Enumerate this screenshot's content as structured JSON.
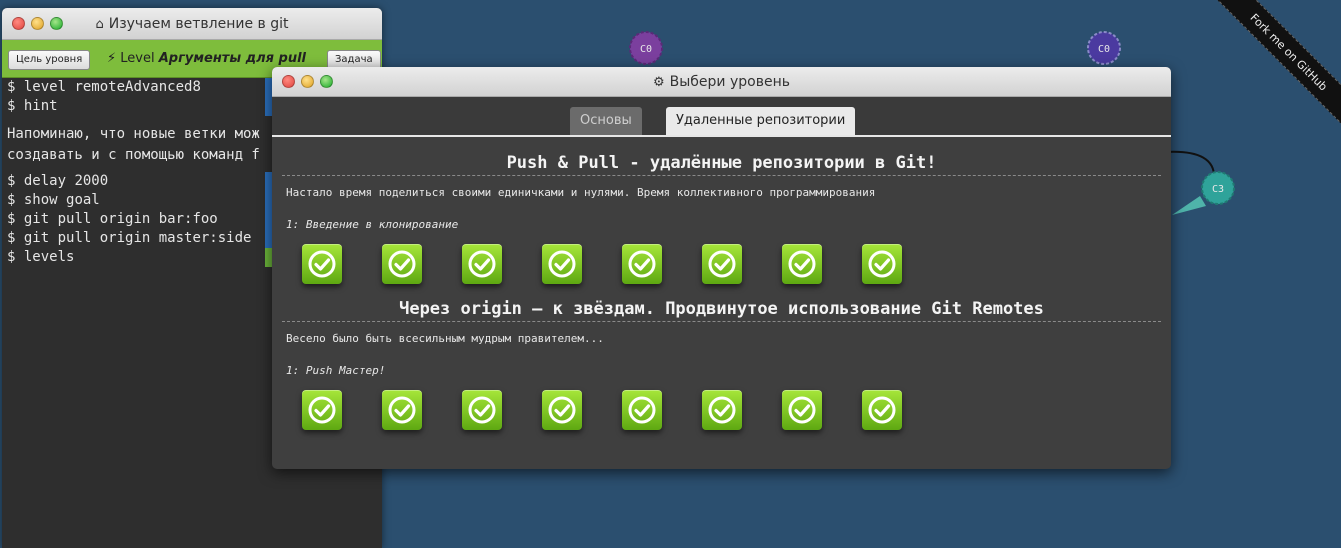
{
  "background": {
    "commits": [
      {
        "label": "C0",
        "color": "#7b3f9e"
      },
      {
        "label": "C0",
        "color": "#4b3aa0"
      },
      {
        "label": "C3",
        "color": "#2fa39a"
      }
    ]
  },
  "ribbon": {
    "text": "Fork me on GitHub"
  },
  "terminal": {
    "title": "Изучаем ветвление в git",
    "title_icon": "home-icon",
    "toolbar": {
      "goal_button": "Цель уровня",
      "level_prefix": "Level",
      "level_name": "Аргументы для pull",
      "task_button": "Задача"
    },
    "commands_top": [
      {
        "prompt": "$",
        "text": "level remoteAdvanced8",
        "status": "#2a6ebb"
      },
      {
        "prompt": "$",
        "text": "hint",
        "status": "#2a6ebb"
      }
    ],
    "message_lines": [
      "Напоминаю, что новые ветки мож",
      "создавать и с помощью команд f"
    ],
    "commands_bottom": [
      {
        "prompt": "$",
        "text": "delay 2000",
        "status": "#2a6ebb"
      },
      {
        "prompt": "$",
        "text": "show goal",
        "status": "#2a6ebb"
      },
      {
        "prompt": "$",
        "text": "git pull origin bar:foo",
        "status": "#2a6ebb"
      },
      {
        "prompt": "$",
        "text": "git pull origin master:side",
        "status": "#2a6ebb"
      },
      {
        "prompt": "$",
        "text": "levels",
        "status": "#6ab43a"
      }
    ]
  },
  "modal": {
    "title": "Выбери уровень",
    "title_icon": "gear-icon",
    "tabs": [
      {
        "label": "Основы",
        "active": false
      },
      {
        "label": "Удаленные репозитории",
        "active": true
      }
    ],
    "sequences": [
      {
        "title": "Push & Pull - удалённые репозитории в Git!",
        "about": "Настало время поделиться своими единичками и нулями. Время коллективного программирования",
        "selected_level": "1: Введение в клонирование",
        "levels_solved": [
          true,
          true,
          true,
          true,
          true,
          true,
          true,
          true
        ]
      },
      {
        "title": "Через origin – к звёздам. Продвинутое использование Git Remotes",
        "about": "Весело было быть всесильным мудрым правителем...",
        "selected_level": "1: Push Мастер!",
        "levels_solved": [
          true,
          true,
          true,
          true,
          true,
          true,
          true,
          true
        ]
      }
    ],
    "accent": "#7ebd3c"
  }
}
